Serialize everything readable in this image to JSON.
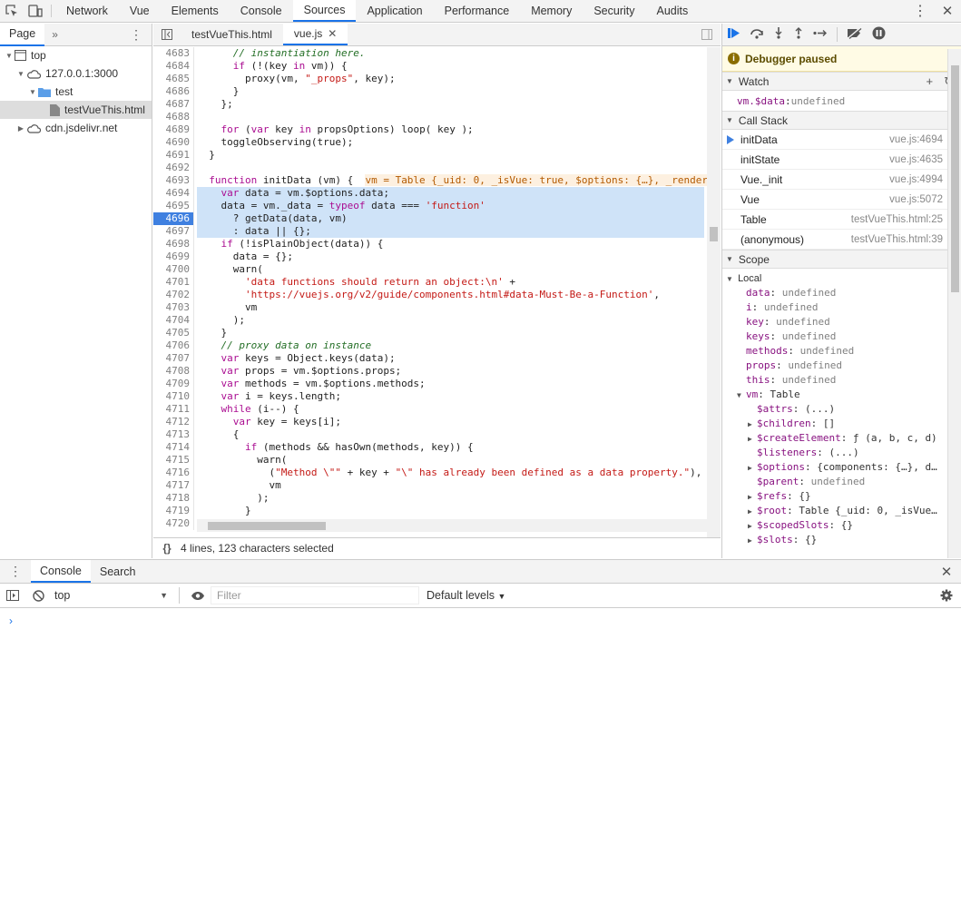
{
  "topbar": {
    "tabs": [
      "Network",
      "Vue",
      "Elements",
      "Console",
      "Sources",
      "Application",
      "Performance",
      "Memory",
      "Security",
      "Audits"
    ],
    "active_tab": "Sources"
  },
  "navigator": {
    "tab_label": "Page",
    "tree": [
      {
        "label": "top",
        "depth": 0,
        "icon": "frame-icon",
        "expanded": true
      },
      {
        "label": "127.0.0.1:3000",
        "depth": 1,
        "icon": "cloud-icon",
        "expanded": true
      },
      {
        "label": "test",
        "depth": 2,
        "icon": "folder-icon",
        "expanded": true
      },
      {
        "label": "testVueThis.html",
        "depth": 3,
        "icon": "file-icon",
        "selected": true
      },
      {
        "label": "cdn.jsdelivr.net",
        "depth": 1,
        "icon": "cloud-icon",
        "expanded": false
      }
    ]
  },
  "editor": {
    "tabs": [
      {
        "label": "testVueThis.html",
        "active": false
      },
      {
        "label": "vue.js",
        "active": true,
        "closable": true
      }
    ],
    "breakpoint_line": 4696,
    "lines": [
      {
        "n": "4683",
        "code": "      // instantiation here."
      },
      {
        "n": "4684",
        "code": "      if (!(key in vm)) {"
      },
      {
        "n": "4685",
        "code": "        proxy(vm, \"_props\", key);"
      },
      {
        "n": "4686",
        "code": "      }"
      },
      {
        "n": "4687",
        "code": "    };"
      },
      {
        "n": "4688",
        "code": ""
      },
      {
        "n": "4689",
        "code": "    for (var key in propsOptions) loop( key );"
      },
      {
        "n": "4690",
        "code": "    toggleObserving(true);"
      },
      {
        "n": "4691",
        "code": "  }"
      },
      {
        "n": "4692",
        "code": ""
      },
      {
        "n": "4693",
        "code": "  function initData (vm) {  ",
        "inline": "vm = Table {_uid: 0, _isVue: true, $options: {…}, _render"
      },
      {
        "n": "4694",
        "code": "    var data = vm.$options.data;",
        "hl": true
      },
      {
        "n": "4695",
        "code": "    data = vm._data = typeof data === 'function'",
        "hl": true
      },
      {
        "n": "4696",
        "code": "      ? getData(data, vm)",
        "hl": true,
        "bp": true
      },
      {
        "n": "4697",
        "code": "      : data || {};",
        "hl": true
      },
      {
        "n": "4698",
        "code": "    if (!isPlainObject(data)) {"
      },
      {
        "n": "4699",
        "code": "      data = {};"
      },
      {
        "n": "4700",
        "code": "      warn("
      },
      {
        "n": "4701",
        "code": "        'data functions should return an object:\\n' +"
      },
      {
        "n": "4702",
        "code": "        'https://vuejs.org/v2/guide/components.html#data-Must-Be-a-Function',"
      },
      {
        "n": "4703",
        "code": "        vm"
      },
      {
        "n": "4704",
        "code": "      );"
      },
      {
        "n": "4705",
        "code": "    }"
      },
      {
        "n": "4706",
        "code": "    // proxy data on instance"
      },
      {
        "n": "4707",
        "code": "    var keys = Object.keys(data);"
      },
      {
        "n": "4708",
        "code": "    var props = vm.$options.props;"
      },
      {
        "n": "4709",
        "code": "    var methods = vm.$options.methods;"
      },
      {
        "n": "4710",
        "code": "    var i = keys.length;"
      },
      {
        "n": "4711",
        "code": "    while (i--) {"
      },
      {
        "n": "4712",
        "code": "      var key = keys[i];"
      },
      {
        "n": "4713",
        "code": "      {"
      },
      {
        "n": "4714",
        "code": "        if (methods && hasOwn(methods, key)) {"
      },
      {
        "n": "4715",
        "code": "          warn("
      },
      {
        "n": "4716",
        "code": "            (\"Method \\\"\" + key + \"\\\" has already been defined as a data property.\"),"
      },
      {
        "n": "4717",
        "code": "            vm"
      },
      {
        "n": "4718",
        "code": "          );"
      },
      {
        "n": "4719",
        "code": "        }"
      },
      {
        "n": "4720",
        "code": ""
      }
    ],
    "status": "4 lines, 123 characters selected"
  },
  "debugger": {
    "paused_label": "Debugger paused",
    "watch_label": "Watch",
    "watch": [
      {
        "name": "vm.$data",
        "value": "undefined"
      }
    ],
    "callstack_label": "Call Stack",
    "callstack": [
      {
        "fn": "initData",
        "loc": "vue.js:4694",
        "current": true
      },
      {
        "fn": "initState",
        "loc": "vue.js:4635"
      },
      {
        "fn": "Vue._init",
        "loc": "vue.js:4994"
      },
      {
        "fn": "Vue",
        "loc": "vue.js:5072"
      },
      {
        "fn": "Table",
        "loc": "testVueThis.html:25"
      },
      {
        "fn": "(anonymous)",
        "loc": "testVueThis.html:39"
      }
    ],
    "scope_label": "Scope",
    "local_label": "Local",
    "scope": [
      {
        "name": "data",
        "value": "undefined",
        "depth": 1
      },
      {
        "name": "i",
        "value": "undefined",
        "depth": 1
      },
      {
        "name": "key",
        "value": "undefined",
        "depth": 1
      },
      {
        "name": "keys",
        "value": "undefined",
        "depth": 1
      },
      {
        "name": "methods",
        "value": "undefined",
        "depth": 1
      },
      {
        "name": "props",
        "value": "undefined",
        "depth": 1
      },
      {
        "name": "this",
        "value": "undefined",
        "depth": 1
      },
      {
        "name": "vm",
        "value": "Table",
        "depth": 1,
        "expandable": true,
        "expanded": true
      },
      {
        "name": "$attrs",
        "value": "(...)",
        "depth": 2
      },
      {
        "name": "$children",
        "value": "[]",
        "depth": 2,
        "expandable": true
      },
      {
        "name": "$createElement",
        "value": "ƒ (a, b, c, d)",
        "depth": 2,
        "expandable": true
      },
      {
        "name": "$listeners",
        "value": "(...)",
        "depth": 2
      },
      {
        "name": "$options",
        "value": "{components: {…}, d…",
        "depth": 2,
        "expandable": true
      },
      {
        "name": "$parent",
        "value": "undefined",
        "depth": 2
      },
      {
        "name": "$refs",
        "value": "{}",
        "depth": 2,
        "expandable": true
      },
      {
        "name": "$root",
        "value": "Table {_uid: 0, _isVue…",
        "depth": 2,
        "expandable": true
      },
      {
        "name": "$scopedSlots",
        "value": "{}",
        "depth": 2,
        "expandable": true
      },
      {
        "name": "$slots",
        "value": "{}",
        "depth": 2,
        "expandable": true
      }
    ]
  },
  "drawer": {
    "tabs": [
      "Console",
      "Search"
    ],
    "active_tab": "Console",
    "context": "top",
    "filter_placeholder": "Filter",
    "levels_label": "Default levels",
    "prompt": "›"
  }
}
